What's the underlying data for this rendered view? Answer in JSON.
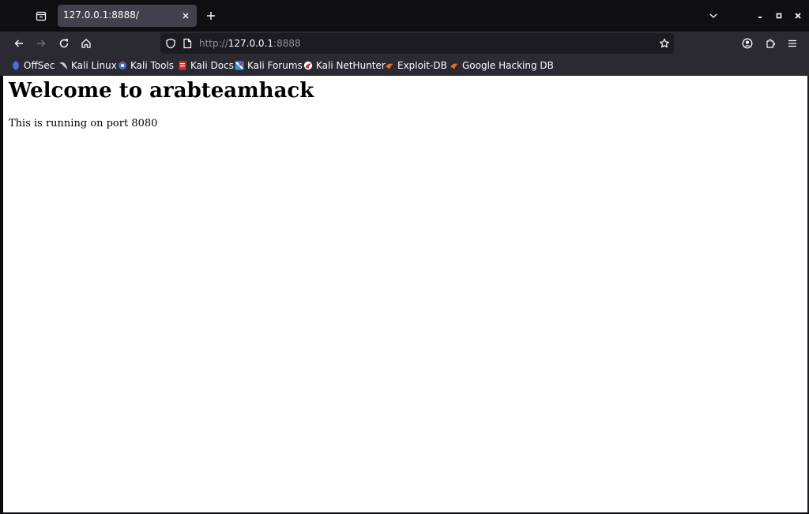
{
  "tab": {
    "title": "127.0.0.1:8888/"
  },
  "urlbar": {
    "scheme": "http://",
    "host": "127.0.0.1",
    "port": ":8888"
  },
  "bookmarks": [
    {
      "label": "OffSec",
      "icon": "offsec-icon",
      "color": "#3d6fd1"
    },
    {
      "label": "Kali Linux",
      "icon": "kali-dragon-icon",
      "color": "#d0d0d0"
    },
    {
      "label": "Kali Tools",
      "icon": "kali-tools-icon",
      "color": "#3d6fd1"
    },
    {
      "label": "Kali Docs",
      "icon": "kali-docs-icon",
      "color": "#d0312d"
    },
    {
      "label": "Kali Forums",
      "icon": "kali-forums-icon",
      "color": "#3b8fd8"
    },
    {
      "label": "Kali NetHunter",
      "icon": "nethunter-icon",
      "color": "#d0312d"
    },
    {
      "label": "Exploit-DB",
      "icon": "exploit-db-icon",
      "color": "#e8692a"
    },
    {
      "label": "Google Hacking DB",
      "icon": "ghdb-icon",
      "color": "#e8692a"
    }
  ],
  "page": {
    "heading": "Welcome to arabteamhack",
    "paragraph": "This is running on port 8080"
  }
}
